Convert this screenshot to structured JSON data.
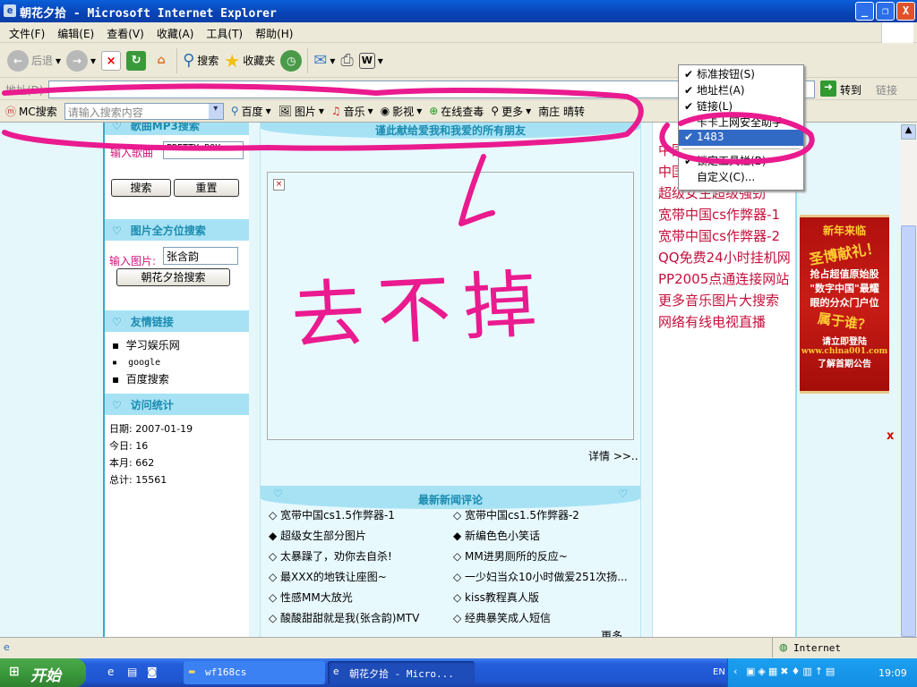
{
  "window": {
    "title": "朝花夕拾 - Microsoft Internet Explorer",
    "minimize": "_",
    "restore": "❐",
    "close": "X"
  },
  "menu": [
    "文件(F)",
    "编辑(E)",
    "查看(V)",
    "收藏(A)",
    "工具(T)",
    "帮助(H)"
  ],
  "toolbar": {
    "back": "后退",
    "search": "搜索",
    "favorites": "收藏夹"
  },
  "address": {
    "label": "地址(D)",
    "go": "转到",
    "links": "链接"
  },
  "searchbar": {
    "brand": "MC搜索",
    "placeholder": "请输入搜索内容",
    "items": [
      "百度",
      "图片",
      "音乐",
      "影视",
      "在线查毒",
      "更多"
    ],
    "trailing": "南庄 晴转"
  },
  "dropdown": {
    "items": [
      {
        "label": "标准按钮(S)",
        "checked": true
      },
      {
        "label": "地址栏(A)",
        "checked": true
      },
      {
        "label": "链接(L)",
        "checked": true
      },
      {
        "label": "卡卡上网安全助手",
        "checked": false
      },
      {
        "label": "1483",
        "checked": true,
        "selected": true
      },
      {
        "label": "锁定工具栏(B)",
        "checked": true
      },
      {
        "label": "自定义(C)...",
        "checked": false
      }
    ]
  },
  "left": {
    "song_section": "歌曲MP3搜索",
    "song_label": "输入歌曲",
    "song_value": "PRETTY BOY",
    "search_btn": "搜索",
    "reset_btn": "重置",
    "image_section": "图片全方位搜索",
    "image_label": "输入图片:",
    "image_value": "张含韵",
    "image_btn": "朝花夕拾搜索",
    "links_section": "友情链接",
    "links": [
      "学习娱乐网",
      "google",
      "百度搜索"
    ],
    "stats_section": "访问统计",
    "stats": [
      "日期: 2007-01-19",
      "今日: 16",
      "本月: 662",
      "总计: 15561"
    ]
  },
  "center": {
    "banner": "谨此献给爱我和我爱的所有朋友",
    "detail": "详情 >>..",
    "news_title": "最新新闻评论",
    "news_left": [
      {
        "t": "宽带中国cs1.5作弊器-1",
        "filled": false
      },
      {
        "t": "超级女生部分图片",
        "filled": true
      },
      {
        "t": "太暴躁了，劝你去自杀!",
        "filled": false
      },
      {
        "t": "最XXX的地铁让座图~",
        "filled": false
      },
      {
        "t": "性感MM大放光",
        "filled": false
      },
      {
        "t": "酸酸甜甜就是我(张含韵)MTV",
        "filled": false
      }
    ],
    "news_right": [
      {
        "t": "宽带中国cs1.5作弊器-2",
        "filled": false
      },
      {
        "t": "新编色色小笑话",
        "filled": true
      },
      {
        "t": "MM进男厕所的反应~",
        "filled": false
      },
      {
        "t": "一少妇当众10小时做爱251次扬...",
        "filled": false
      },
      {
        "t": "kiss教程真人版",
        "filled": false
      },
      {
        "t": "经典暴笑成人短信",
        "filled": false
      }
    ],
    "more": "更多"
  },
  "right": {
    "links": [
      "中国",
      "中国",
      "超级女生超级强劲",
      "宽带中国cs作弊器-1",
      "宽带中国cs作弊器-2",
      "QQ免费24小时挂机网",
      "PP2005点通连接网站",
      "更多音乐图片大搜索",
      "网络有线电视直播"
    ]
  },
  "ad": {
    "lines": [
      "新年来临",
      "圣博献礼！",
      "抢占超值原始股",
      "\"数字中国\"最耀",
      "眼的分众门户位",
      "属于谁？",
      "请立即登陆",
      "www.china001.com",
      "了解首期公告"
    ],
    "close": "x"
  },
  "annotation": {
    "text": "去不掉",
    "color": "#ea1a8f"
  },
  "status": {
    "zone": "Internet"
  },
  "taskbar": {
    "start": "开始",
    "tasks": [
      "wf168cs",
      "朝花夕拾 - Micro..."
    ],
    "lang": "EN",
    "clock": "19:09"
  }
}
